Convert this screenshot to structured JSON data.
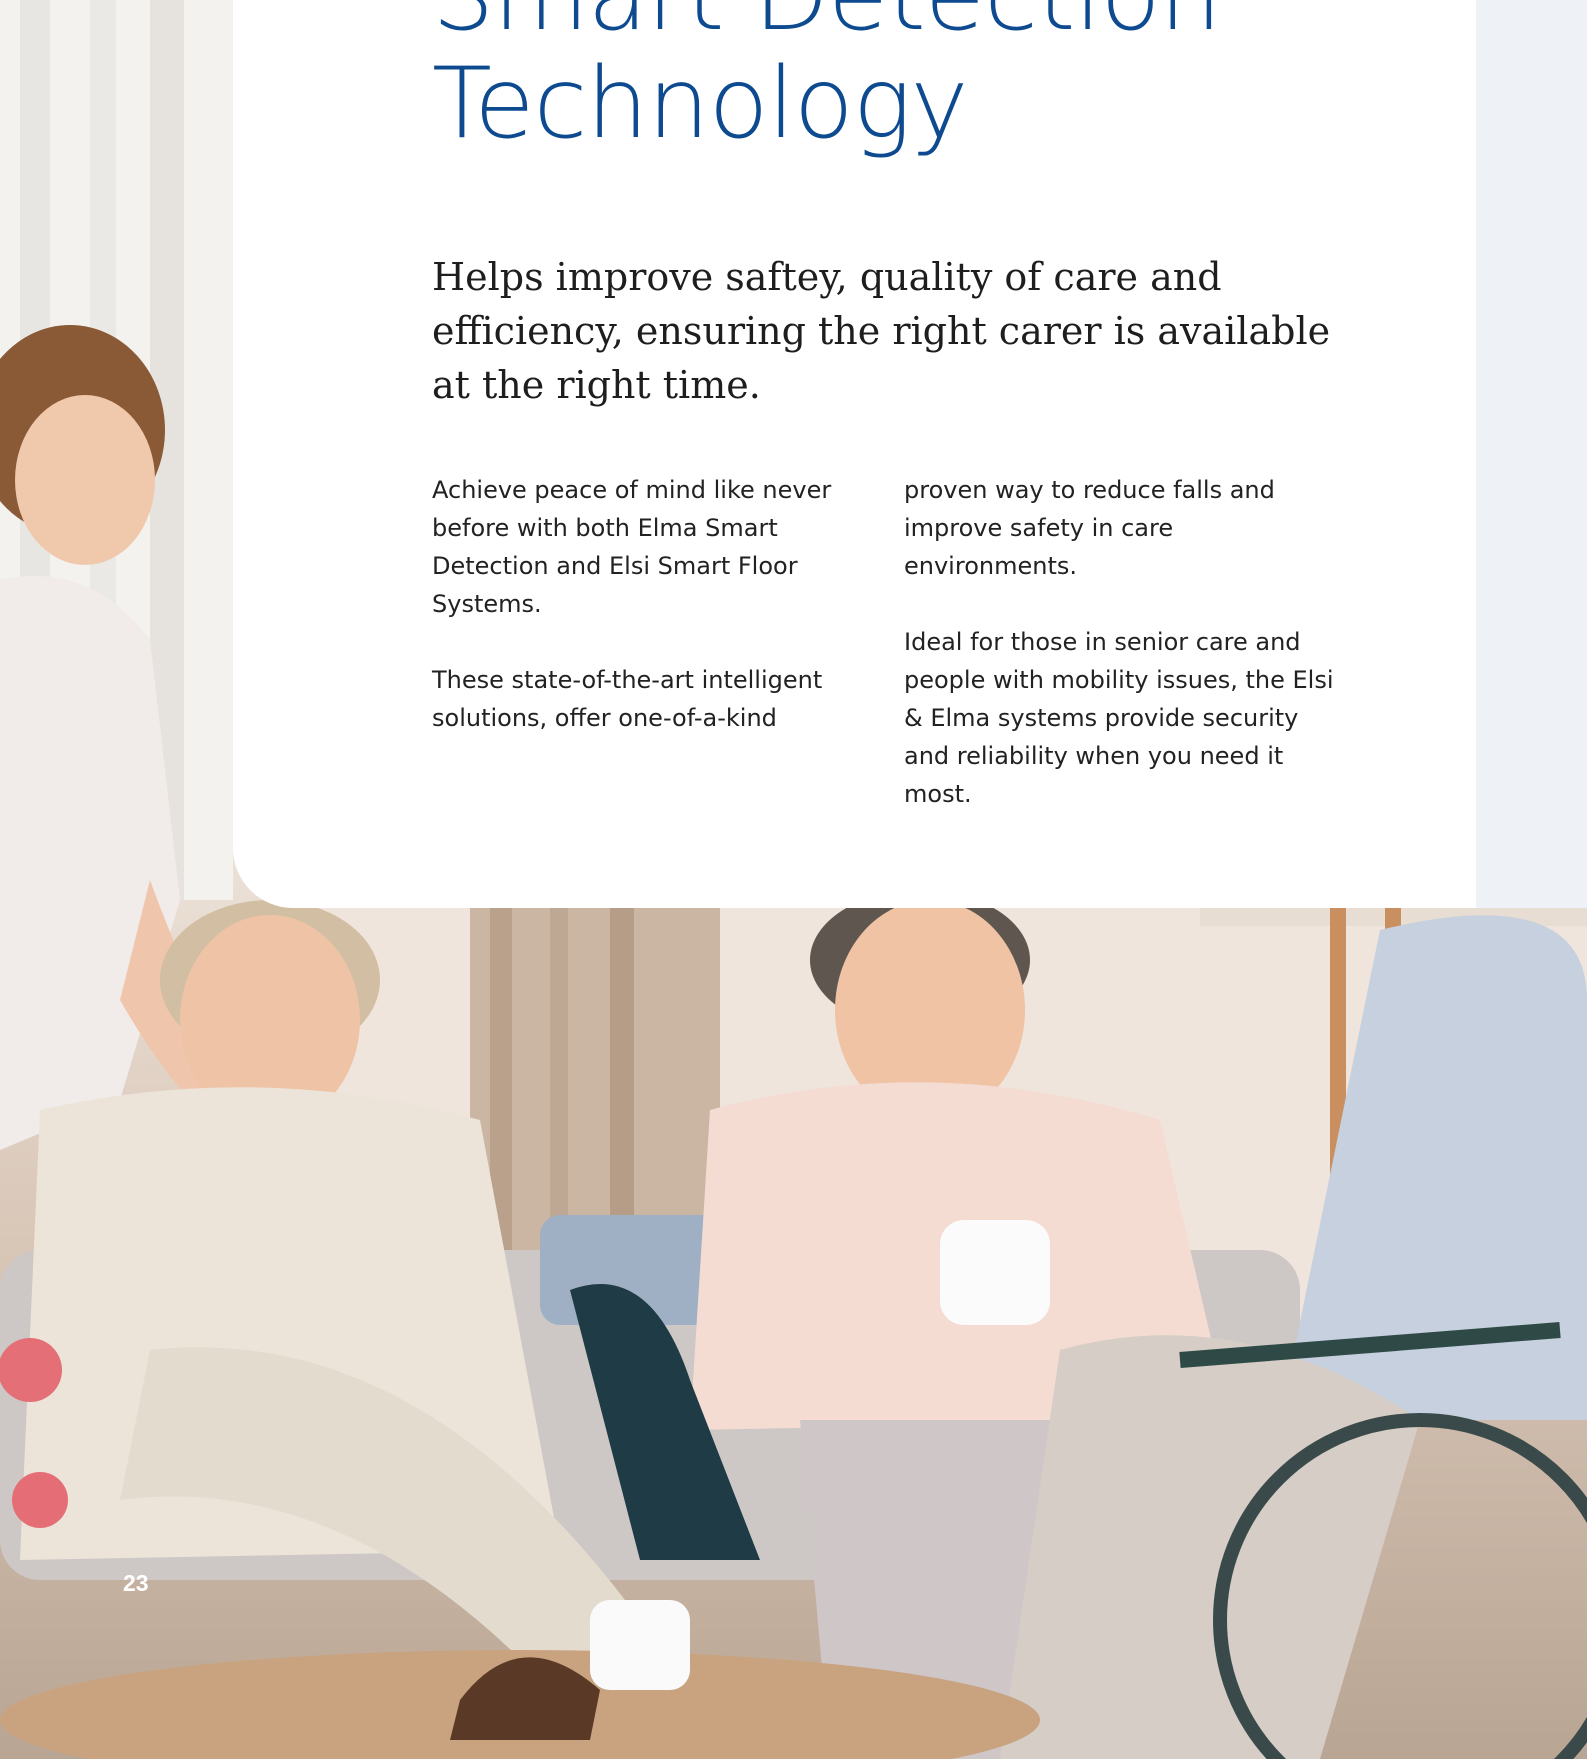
{
  "heading": {
    "line1": "Smart Detection",
    "line2": "Technology"
  },
  "lead": "Helps improve saftey, quality of care and efficiency, ensuring the right carer is available at the right time.",
  "column1": {
    "para1": "Achieve peace of mind like never before with both Elma Smart Detection and Elsi Smart Floor Systems.",
    "para2": "These state-of-the-art intelligent solutions, offer one-of-a-kind"
  },
  "column2": {
    "para1": "proven way to reduce falls and improve safety in care environments.",
    "para2": "Ideal for those in senior care and people with mobility issues, the Elsi & Elma systems provide security and reliability when you need it most."
  },
  "page_number": "23",
  "colors": {
    "heading": "#0d4a8f",
    "card": "#ffffff",
    "background": "#eef1f5"
  }
}
